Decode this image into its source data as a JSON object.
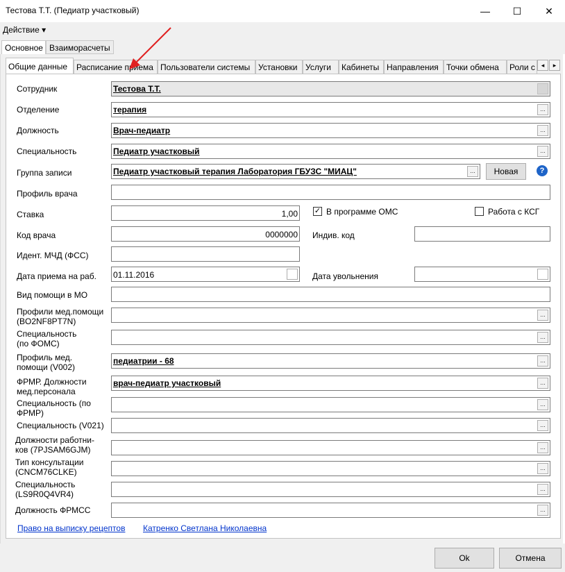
{
  "window": {
    "title": "Тестова Т.Т. (Педиатр участковый)",
    "minimize": "—",
    "maximize": "☐",
    "close": "✕"
  },
  "menu": {
    "action": "Действие ▾"
  },
  "top_tabs": [
    "Основное",
    "Взаиморасчеты"
  ],
  "sub_tabs": [
    "Общие данные",
    "Расписание приема",
    "Пользователи системы",
    "Установки",
    "Услуги",
    "Кабинеты",
    "Направления",
    "Точки обмена",
    "Роли с"
  ],
  "scroll": {
    "left": "◂",
    "right": "▸"
  },
  "form": {
    "employee": {
      "label": "Сотрудник",
      "value": "Тестова Т.Т."
    },
    "department": {
      "label": "Отделение",
      "value": "терапия"
    },
    "position": {
      "label": "Должность",
      "value": "Врач-педиатр"
    },
    "specialty": {
      "label": "Специальность",
      "value": "Педиатр участковый"
    },
    "record_group": {
      "label": "Группа записи",
      "value": "Педиатр участковый терапия Лаборатория ГБУЗС \"МИАЦ\"",
      "new_button": "Новая"
    },
    "doctor_profile": {
      "label": "Профиль врача",
      "value": ""
    },
    "rate": {
      "label": "Ставка",
      "value": "1,00"
    },
    "oms": {
      "label": "В программе ОМС",
      "checked": true
    },
    "ksg": {
      "label": "Работа с КСГ",
      "checked": false
    },
    "doctor_code": {
      "label": "Код врача",
      "value": "0000000"
    },
    "individual_code": {
      "label": "Индив. код",
      "value": ""
    },
    "mvd_id": {
      "label": "Идент. МЧД (ФСС)",
      "value": ""
    },
    "hire_date": {
      "label": "Дата приема на раб.",
      "value": "01.11.2016"
    },
    "dismissal_date": {
      "label": "Дата увольнения",
      "value": ""
    },
    "aid_type": {
      "label": "Вид помощи в МО",
      "value": ""
    },
    "aid_profiles": {
      "label1": "Профили мед.помощи",
      "label2": " (BO2NF8PT7N)",
      "value": ""
    },
    "specialty_foms": {
      "label1": "Специальность",
      "label2": "(по ФОМС)",
      "value": ""
    },
    "aid_profile_v002": {
      "label1": "Профиль мед.",
      "label2": "помощи (V002)",
      "value": "педиатрии - 68"
    },
    "frmr_position": {
      "label1": "ФРМР. Должности",
      "label2": "мед.персонала",
      "value": "врач-педиатр участковый"
    },
    "specialty_frmr": {
      "label1": "Специальность (по",
      "label2": "ФРМР)",
      "value": ""
    },
    "specialty_v021": {
      "label": "Специальность (V021)",
      "value": ""
    },
    "worker_positions": {
      "label1": "Должности работни-",
      "label2": "ков (7PJSAM6GJM)",
      "value": ""
    },
    "consult_type": {
      "label1": "Тип консультации",
      "label2": "(CNCM76CLKE)",
      "value": ""
    },
    "specialty_ls": {
      "label1": "Специальность",
      "label2": "(LS9R0Q4VR4)",
      "value": ""
    },
    "frmss_position": {
      "label": "Должность ФРМСС",
      "value": ""
    }
  },
  "dots": "...",
  "help": "?",
  "links": {
    "prescription": "Право на выписку рецептов",
    "person": "Катренко Светлана Николаевна"
  },
  "buttons": {
    "ok": "Ok",
    "cancel": "Отмена"
  }
}
